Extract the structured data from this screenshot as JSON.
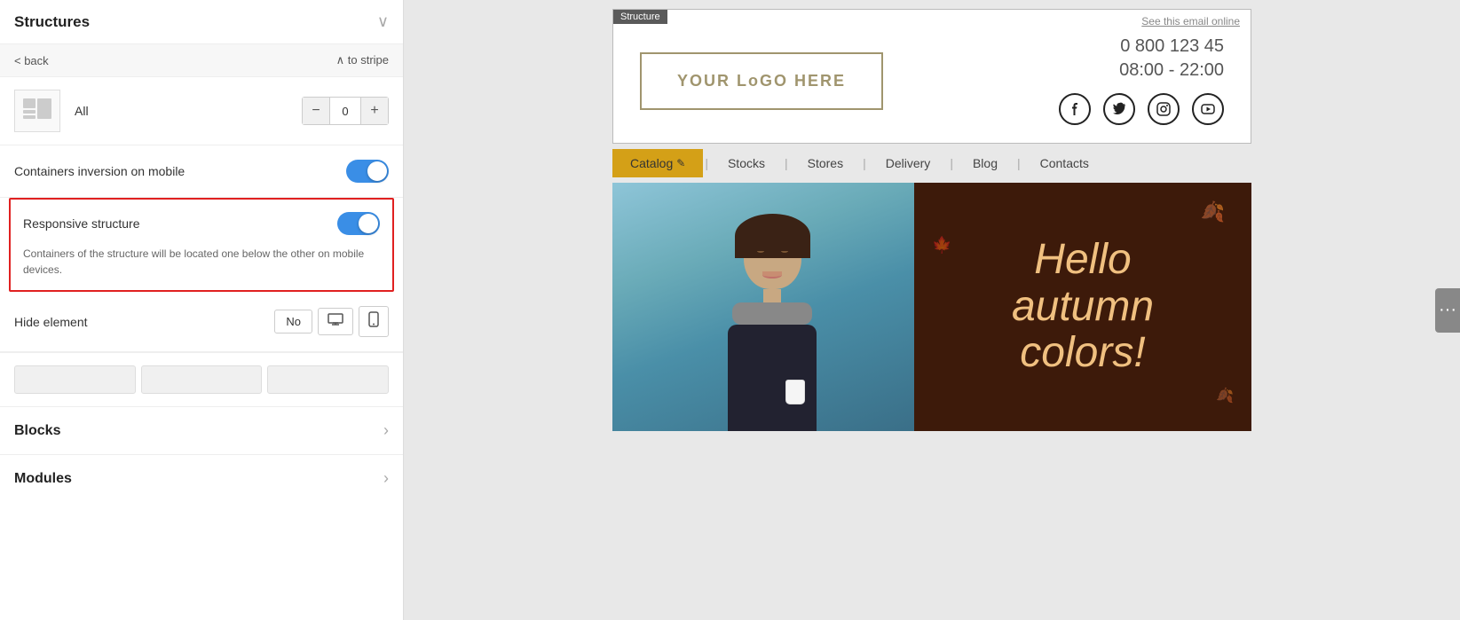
{
  "leftPanel": {
    "title": "Structures",
    "collapseIcon": "∨",
    "nav": {
      "back": "< back",
      "toStripe": "∧ to stripe"
    },
    "allSection": {
      "label": "All",
      "stepperValue": "0",
      "stepperMinus": "−",
      "stepperPlus": "+"
    },
    "containersInversion": {
      "label": "Containers inversion on mobile",
      "enabled": true
    },
    "responsiveStructure": {
      "label": "Responsive structure",
      "enabled": true,
      "description": "Containers of the structure will be located one below the other on mobile devices."
    },
    "hideElement": {
      "label": "Hide element",
      "noLabel": "No",
      "desktopIcon": "🖥",
      "mobileIcon": "📱"
    },
    "bottomButtons": [
      "",
      "",
      ""
    ],
    "sections": [
      {
        "label": "Blocks",
        "arrow": "›"
      },
      {
        "label": "Modules",
        "arrow": "›"
      }
    ]
  },
  "rightPanel": {
    "structureLabel": "Structure",
    "seeOnline": "See this email online",
    "header": {
      "logoText": "YOUR LoGO HERE",
      "phone": "0 800 123 45",
      "hours": "08:00 - 22:00",
      "socialIcons": [
        "facebook",
        "twitter",
        "instagram",
        "youtube"
      ]
    },
    "navbar": {
      "items": [
        {
          "label": "Catalog",
          "active": true,
          "hasEditIcon": true
        },
        {
          "label": "Stocks",
          "active": false
        },
        {
          "label": "Stores",
          "active": false
        },
        {
          "label": "Delivery",
          "active": false
        },
        {
          "label": "Blog",
          "active": false
        },
        {
          "label": "Contacts",
          "active": false
        }
      ],
      "separators": [
        "|",
        "|",
        "|",
        "|",
        "|"
      ]
    },
    "hero": {
      "leftText": "",
      "rightText": {
        "line1": "Hello",
        "line2": "autumn",
        "line3": "colors!"
      }
    },
    "floatBtn": "···"
  }
}
